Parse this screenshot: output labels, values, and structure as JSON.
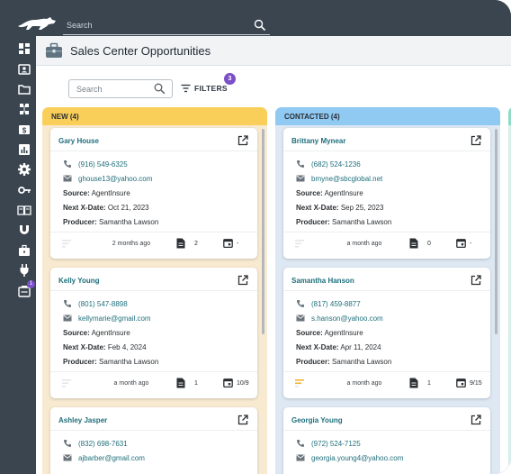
{
  "header": {
    "search_placeholder": "Search",
    "page_title": "Sales Center Opportunities"
  },
  "sidebar": {
    "icons": [
      "dashboard-icon",
      "contacts-icon",
      "folder-icon",
      "org-chart-icon",
      "billing-icon",
      "reports-icon",
      "settings-icon",
      "key-icon",
      "book-icon",
      "magnet-icon",
      "briefcase-icon",
      "plug-icon",
      "inbox-icon"
    ],
    "inbox_badge": "1"
  },
  "toolbar": {
    "search_placeholder": "Search",
    "filters_label": "FILTERS",
    "filters_count": "3"
  },
  "columns": [
    {
      "title": "NEW (4)",
      "color": "#f9cf5a",
      "cards": [
        {
          "name": "Gary House",
          "phone": "(916) 549-6325",
          "email": "ghouse13@yahoo.com",
          "source_label": "Source:",
          "source": "AgentInsure",
          "next_label": "Next X-Date:",
          "next_date": "Oct 21, 2023",
          "producer_label": "Producer:",
          "producer": "Samantha Lawson",
          "ago": "2 months ago",
          "docs": "2",
          "cal": "-"
        },
        {
          "name": "Kelly Young",
          "phone": "(801) 547-8898",
          "email": "kellymarie@gmail.com",
          "source_label": "Source:",
          "source": "AgentInsure",
          "next_label": "Next X-Date:",
          "next_date": "Feb 4, 2024",
          "producer_label": "Producer:",
          "producer": "Samantha Lawson",
          "ago": "a month ago",
          "docs": "1",
          "cal": "10/9"
        },
        {
          "name": "Ashley Jasper",
          "phone": "(832) 698-7631",
          "email": "ajbarber@gmail.com"
        }
      ]
    },
    {
      "title": "CONTACTED (4)",
      "color": "#90c9f2",
      "cards": [
        {
          "name": "Brittany Mynear",
          "phone": "(682) 524-1236",
          "email": "bmyne@sbcglobal.net",
          "source_label": "Source:",
          "source": "AgentInsure",
          "next_label": "Next X-Date:",
          "next_date": "Sep 25, 2023",
          "producer_label": "Producer:",
          "producer": "Samantha Lawson",
          "ago": "a month ago",
          "docs": "0",
          "cal": "-"
        },
        {
          "name": "Samantha Hanson",
          "phone": "(817) 459-8877",
          "email": "s.hanson@yahoo.com",
          "source_label": "Source:",
          "source": "AgentInsure",
          "next_label": "Next X-Date:",
          "next_date": "Apr 11, 2024",
          "producer_label": "Producer:",
          "producer": "Samantha Lawson",
          "ago": "a month ago",
          "docs": "1",
          "cal": "9/15"
        },
        {
          "name": "Georgia Young",
          "phone": "(972) 524-7125",
          "email": "georgia.young4@yahoo.com"
        }
      ]
    }
  ]
}
